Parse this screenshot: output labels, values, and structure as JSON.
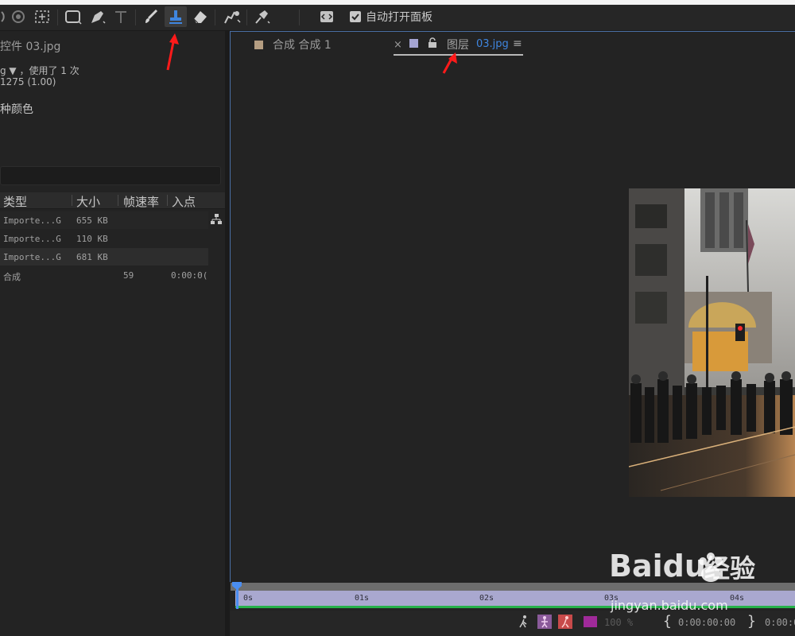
{
  "toolbar": {
    "auto_open_label": "自动打开面板",
    "auto_open_checked": true,
    "tools": [
      "hand-icon",
      "rotate-icon",
      "camera-orbit-icon",
      "mask-rectangle-icon",
      "pen-icon",
      "type-icon",
      "brush-icon",
      "clone-stamp-icon",
      "eraser-icon",
      "roto-brush-icon",
      "puppet-pin-icon",
      "auto-open-panel-icon"
    ]
  },
  "effect_controls": {
    "title": "控件 03.jpg",
    "used_text": "g ▼ ，使用了 1 次",
    "dimensions": "1275 (1.00)",
    "color_text": "种颜色"
  },
  "project": {
    "columns": [
      "类型",
      "大小",
      "帧速率",
      "入点"
    ],
    "rows": [
      {
        "type": "Importe...G",
        "size": "655 KB",
        "fps": "",
        "in": ""
      },
      {
        "type": "Importe...G",
        "size": "110 KB",
        "fps": "",
        "in": ""
      },
      {
        "type": "Importe...G",
        "size": "681 KB",
        "fps": "",
        "in": ""
      },
      {
        "type": "合成",
        "size": "",
        "fps": "59",
        "in": "0:00:0("
      }
    ]
  },
  "viewer": {
    "comp_tab": "合成 合成 1",
    "layer_tab_prefix": "图层",
    "layer_tab_file": "03.jpg",
    "close_glyph": "×",
    "menu_glyph": "≡"
  },
  "timeline": {
    "ticks": [
      "0s",
      "01s",
      "02s",
      "03s",
      "04s"
    ],
    "timecode_in": "0:00:00:00",
    "timecode_out": "0:00:0",
    "zoom": "100 %"
  },
  "watermark": {
    "brand": "Baidu",
    "brand_suffix": "经验",
    "url": "jingyan.baidu.com"
  },
  "colors": {
    "accent_blue": "#4a8df0",
    "tab_active": "#3f86e0",
    "ruler": "#a9a8cf",
    "annotation_red": "#ff1a1a"
  }
}
